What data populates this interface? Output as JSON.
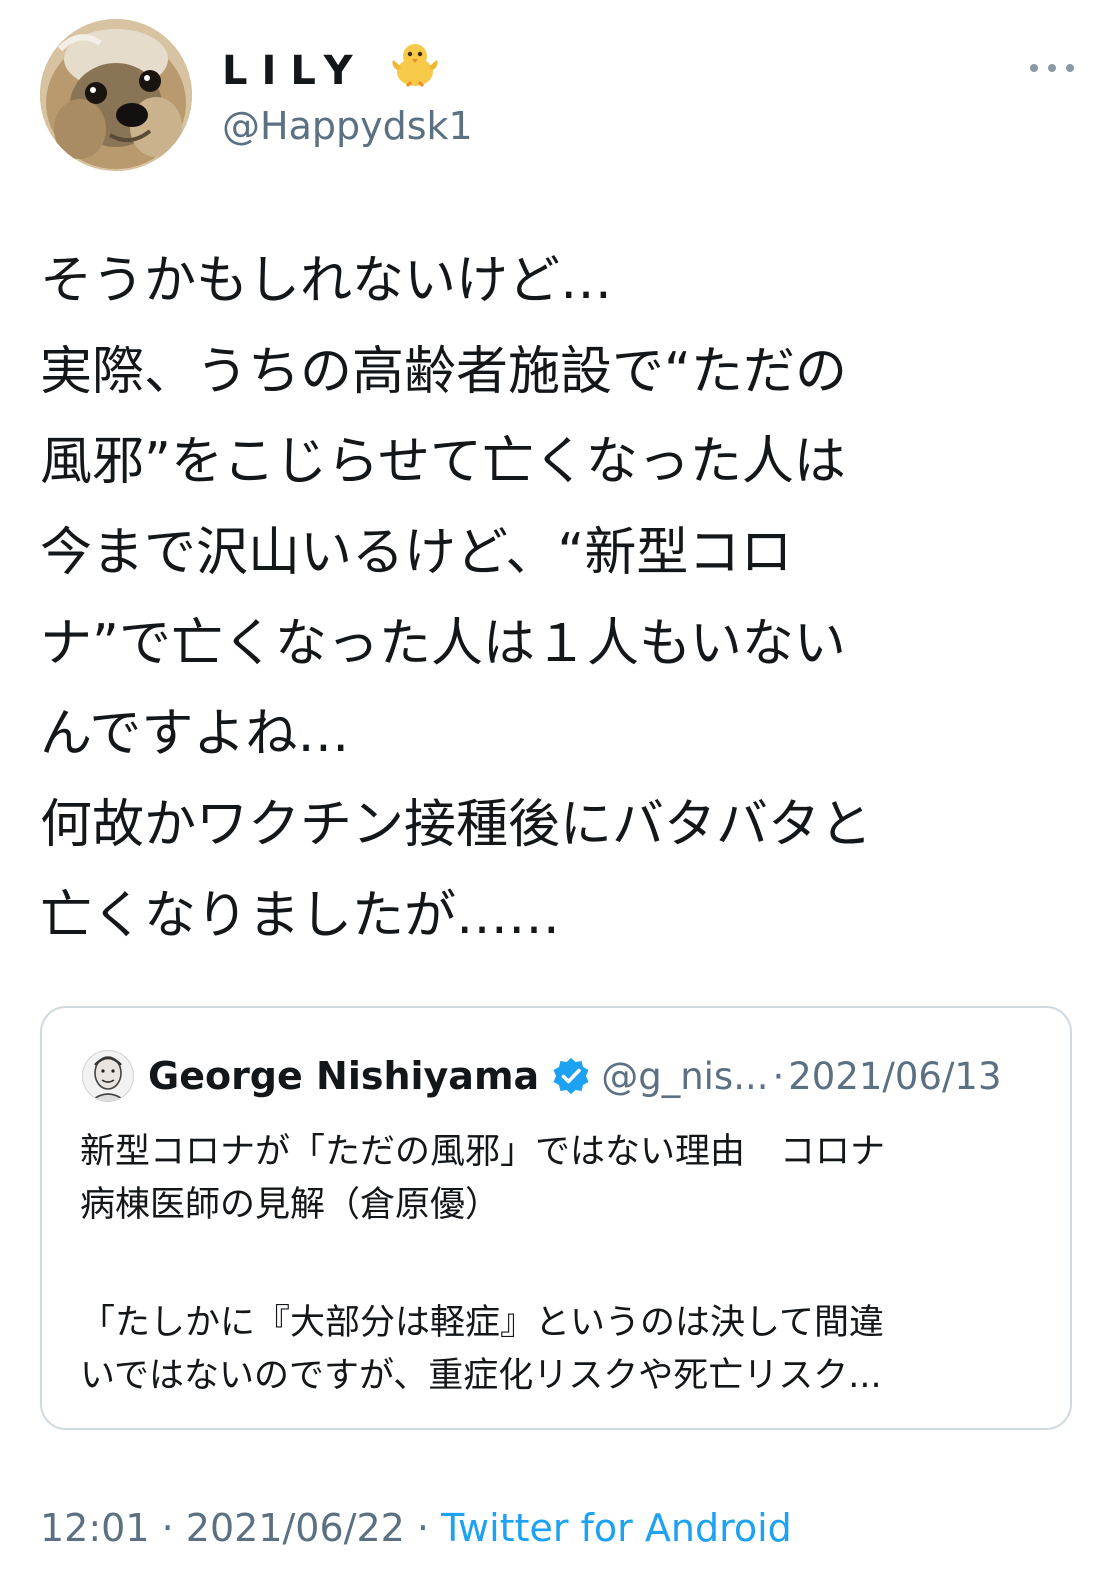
{
  "author": {
    "display_name": "LILY",
    "handle": "@Happydsk1",
    "avatar": "yorkshire-terrier-avatar",
    "name_emoji": "baby-chick-emoji"
  },
  "tweet": {
    "lines": [
      "そうかもしれないけど…",
      "実際、うちの高齢者施設で“ただの",
      "風邪”をこじらせて亡くなった人は",
      "今まで沢山いるけど、“新型コロ",
      "ナ”で亡くなった人は１人もいない",
      "んですよね…",
      "何故かワクチン接種後にバタバタと",
      "亡くなりましたが……"
    ]
  },
  "quoted_tweet": {
    "name": "George Nishiyama",
    "verified_icon": "verified-badge-icon",
    "handle": "@g_nis...",
    "separator": "·",
    "date": "2021/06/13",
    "line1": "新型コロナが「ただの風邪」ではない理由　コロナ",
    "line2": "病棟医師の見解（倉原優）",
    "line3": "「たしかに『大部分は軽症』というのは決して間違",
    "line4": "いではないのですが、重症化リスクや死亡リスク..."
  },
  "meta": {
    "time": "12:01",
    "separator": "·",
    "date": "2021/06/22",
    "source": "Twitter for Android"
  },
  "colors": {
    "text": "#14171a",
    "secondary": "#5b7083",
    "link": "#1da1f2",
    "border": "#cfd9de"
  },
  "icons": [
    "more-icon"
  ]
}
